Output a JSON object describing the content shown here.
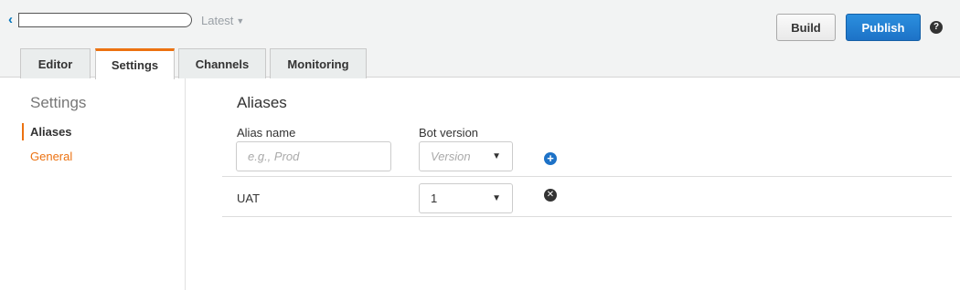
{
  "header": {
    "back_glyph": "‹",
    "bot_version_selector": "Latest",
    "build_label": "Build",
    "publish_label": "Publish",
    "help_glyph": "?"
  },
  "tabs": [
    {
      "label": "Editor",
      "active": false
    },
    {
      "label": "Settings",
      "active": true
    },
    {
      "label": "Channels",
      "active": false
    },
    {
      "label": "Monitoring",
      "active": false
    }
  ],
  "sidebar": {
    "title": "Settings",
    "items": [
      {
        "label": "Aliases",
        "active": true
      },
      {
        "label": "General",
        "active": false
      }
    ]
  },
  "main": {
    "title": "Aliases",
    "columns": {
      "alias_name": "Alias name",
      "bot_version": "Bot version"
    },
    "new_alias": {
      "name_placeholder": "e.g., Prod",
      "version_placeholder": "Version"
    },
    "aliases": [
      {
        "name": "UAT",
        "version": "1"
      }
    ]
  },
  "colors": {
    "accent_orange": "#ec7211",
    "primary_blue": "#1d72c7",
    "header_bg": "#f2f3f3"
  },
  "icons": {
    "back": "chevron-left-icon",
    "dropdown": "caret-down-icon",
    "help": "help-circle-icon",
    "add": "plus-circle-icon",
    "remove": "close-circle-icon"
  }
}
